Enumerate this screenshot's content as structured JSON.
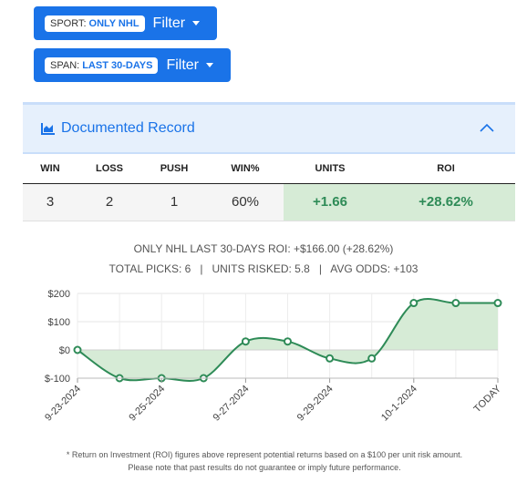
{
  "filters": {
    "sport": {
      "key": "SPORT:",
      "value": "ONLY NHL",
      "label": "Filter"
    },
    "span": {
      "key": "SPAN:",
      "value": "LAST 30-DAYS",
      "label": "Filter"
    }
  },
  "record": {
    "title": "Documented Record",
    "columns": [
      "WIN",
      "LOSS",
      "PUSH",
      "WIN%",
      "UNITS",
      "ROI"
    ],
    "values": [
      "3",
      "2",
      "1",
      "60%",
      "+1.66",
      "+28.62%"
    ]
  },
  "summary": {
    "line1": "ONLY NHL LAST 30-DAYS ROI: +$166.00 (+28.62%)",
    "line2": "TOTAL PICKS: 6   |   UNITS RISKED: 5.8   |   AVG ODDS: +103"
  },
  "chart_data": {
    "type": "area",
    "x": [
      "9-23-2024",
      "9-24-2024",
      "9-25-2024",
      "9-26-2024",
      "9-27-2024",
      "9-28-2024",
      "9-29-2024",
      "9-30-2024",
      "10-1-2024",
      "10-2-2024",
      "TODAY"
    ],
    "values": [
      0,
      -100,
      -100,
      -100,
      30,
      30,
      -30,
      -30,
      166,
      166,
      166
    ],
    "xtick_labels": [
      "9-23-2024",
      "9-25-2024",
      "9-27-2024",
      "9-29-2024",
      "10-1-2024",
      "TODAY"
    ],
    "ytick_labels": [
      "$200",
      "$100",
      "$0",
      "$-100"
    ],
    "ylim": [
      -100,
      200
    ],
    "grid": true,
    "line_color": "#2e8b57",
    "fill_color": "#d6ebd6"
  },
  "disclaimer": "* Return on Investment (ROI) figures above represent potential returns based on a $100 per unit risk amount. Please note that past results do not guarantee or imply future performance.",
  "colors": {
    "accent": "#1a73e8",
    "positive": "#2e8b57"
  }
}
